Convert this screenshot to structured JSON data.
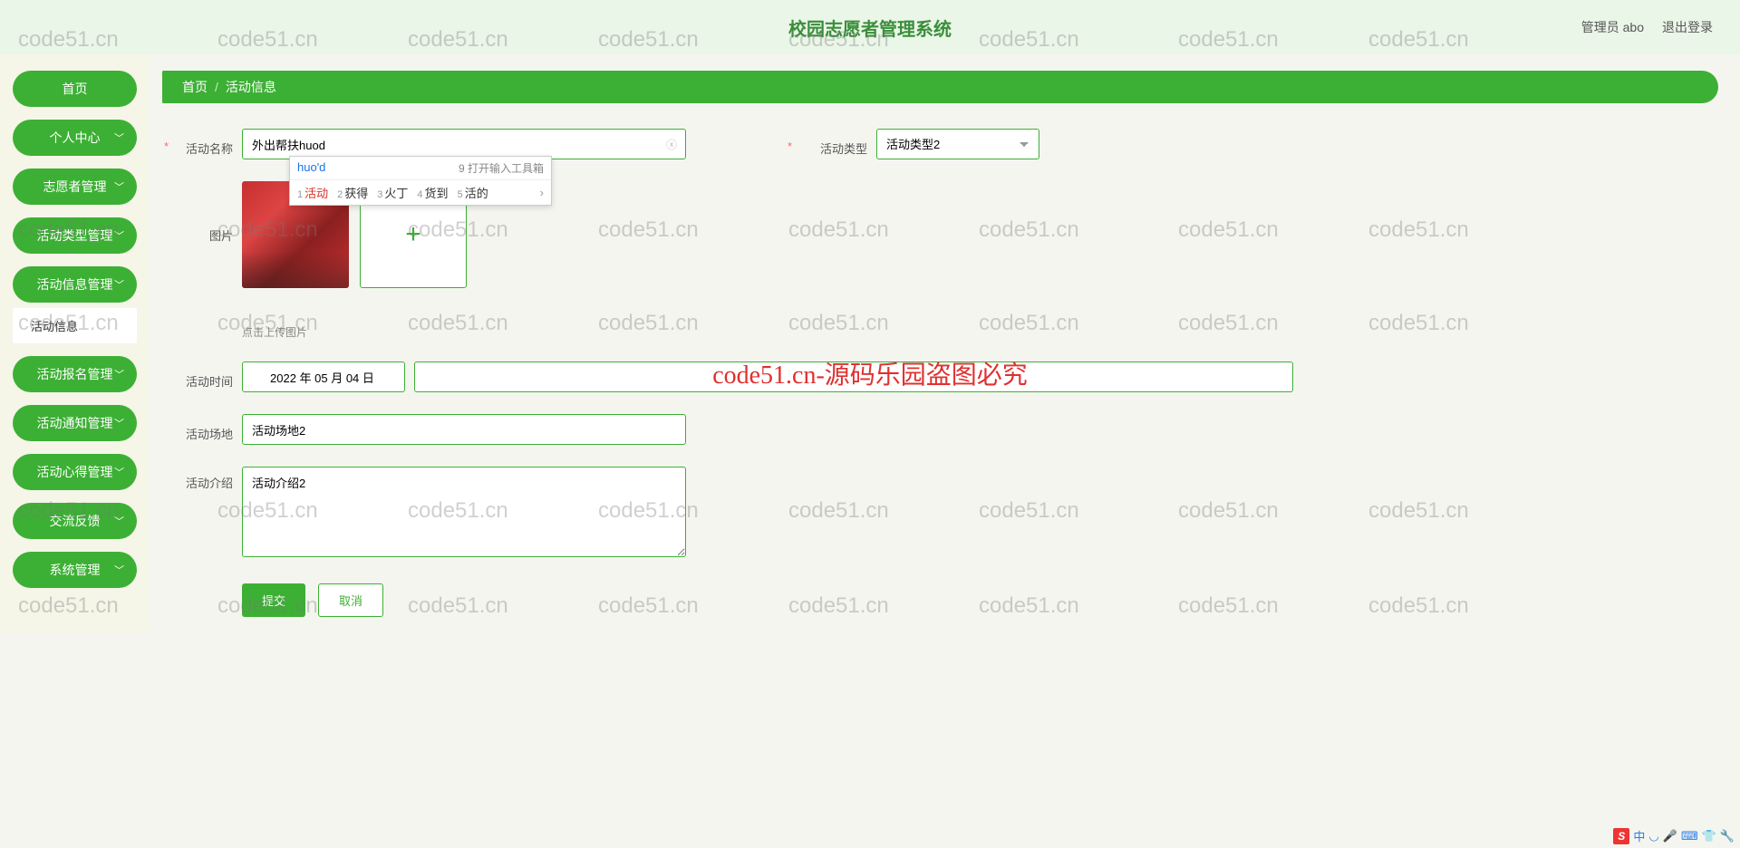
{
  "header": {
    "title": "校园志愿者管理系统",
    "user": "管理员 abo",
    "logout": "退出登录"
  },
  "sidebar": {
    "items": [
      {
        "label": "首页",
        "expandable": false
      },
      {
        "label": "个人中心",
        "expandable": true
      },
      {
        "label": "志愿者管理",
        "expandable": true
      },
      {
        "label": "活动类型管理",
        "expandable": true
      },
      {
        "label": "活动信息管理",
        "expandable": true,
        "sub": "活动信息"
      },
      {
        "label": "活动报名管理",
        "expandable": true
      },
      {
        "label": "活动通知管理",
        "expandable": true
      },
      {
        "label": "活动心得管理",
        "expandable": true
      },
      {
        "label": "交流反馈",
        "expandable": true
      },
      {
        "label": "系统管理",
        "expandable": true
      }
    ]
  },
  "breadcrumb": {
    "home": "首页",
    "current": "活动信息"
  },
  "form": {
    "name_label": "活动名称",
    "name_value": "外出帮扶huod",
    "type_label": "活动类型",
    "type_value": "活动类型2",
    "image_label": "图片",
    "upload_hint": "点击上传图片",
    "time_label": "活动时间",
    "time_value": "2022 年 05 月 04 日",
    "venue_label": "活动场地",
    "venue_value": "活动场地2",
    "intro_label": "活动介绍",
    "intro_value": "活动介绍2",
    "submit": "提交",
    "cancel": "取消"
  },
  "ime": {
    "input": "huo'd",
    "tool_hint": "打开输入工具箱",
    "tool_num": "9",
    "candidates": [
      {
        "n": "1",
        "t": "活动"
      },
      {
        "n": "2",
        "t": "获得"
      },
      {
        "n": "3",
        "t": "火丁"
      },
      {
        "n": "4",
        "t": "货到"
      },
      {
        "n": "5",
        "t": "活的"
      }
    ]
  },
  "watermark": {
    "text": "code51.cn",
    "center": "code51.cn-源码乐园盗图必究"
  },
  "taskbar": {
    "ch": "中"
  }
}
